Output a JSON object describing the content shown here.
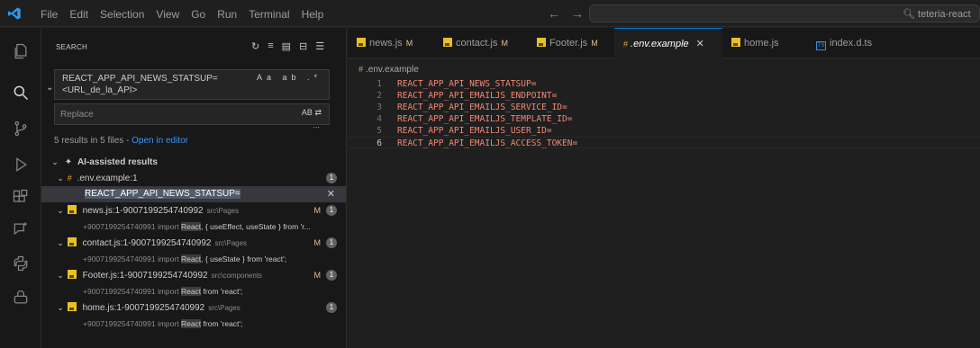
{
  "menu": [
    "File",
    "Edit",
    "Selection",
    "View",
    "Go",
    "Run",
    "Terminal",
    "Help"
  ],
  "nav": {
    "back": "←",
    "forward": "→"
  },
  "command_center": {
    "label": "teteria-react"
  },
  "sidebar": {
    "title": "SEARCH",
    "search_value": "REACT_APP_API_NEWS_STATSUP=<URL_de_la_API>",
    "search_options": "Aa ab .*",
    "replace_placeholder": "Replace",
    "replace_options": "AB",
    "replace_more": "...",
    "results_prefix": "5 results in 5 files - ",
    "open_in_editor": "Open in editor",
    "ai_results_label": "AI-assisted results",
    "env_file": {
      "name": ".env.example:1",
      "count": "1",
      "match": "REACT_APP_API_NEWS_STATSUP="
    },
    "files": [
      {
        "name": "news.js:1-9007199254740992",
        "path": "src\\Pages",
        "flag": "M",
        "count": "1",
        "pre": "+9007199254740991 import ",
        "hit": "React",
        "post": ", { useEffect, useState } from 'r..."
      },
      {
        "name": "contact.js:1-9007199254740992",
        "path": "src\\Pages",
        "flag": "M",
        "count": "1",
        "pre": "+9007199254740991 import ",
        "hit": "React",
        "post": ", { useState } from 'react';"
      },
      {
        "name": "Footer.js:1-9007199254740992",
        "path": "src\\components",
        "flag": "M",
        "count": "1",
        "pre": "+9007199254740991 import ",
        "hit": "React",
        "post": " from 'react';"
      },
      {
        "name": "home.js:1-9007199254740992",
        "path": "src\\Pages",
        "flag": "",
        "count": "1",
        "pre": "+9007199254740991 import ",
        "hit": "React",
        "post": " from 'react';"
      }
    ]
  },
  "tabs": [
    {
      "label": "news.js",
      "flag": "M"
    },
    {
      "label": "contact.js",
      "flag": "M"
    },
    {
      "label": "Footer.js",
      "flag": "M"
    },
    {
      "label": ".env.example",
      "close": "✕"
    },
    {
      "label": "home.js"
    },
    {
      "label": "index.d.ts"
    }
  ],
  "editor": {
    "breadcrumb": ".env.example",
    "lines": [
      {
        "n": "1",
        "text": "REACT_APP_API_NEWS_STATSUP="
      },
      {
        "n": "2",
        "text": "REACT_APP_API_EMAILJS_ENDPOINT="
      },
      {
        "n": "3",
        "text": "REACT_APP_API_EMAILJS_SERVICE_ID="
      },
      {
        "n": "4",
        "text": "REACT_APP_API_EMAILJS_TEMPLATE_ID="
      },
      {
        "n": "5",
        "text": "REACT_APP_API_EMAILJS_USER_ID="
      },
      {
        "n": "6",
        "text": "REACT_APP_API_EMAILJS_ACCESS_TOKEN="
      }
    ]
  },
  "colors": {
    "accent": "#0078d4",
    "token": "#f48771",
    "modified": "#e2c08d",
    "link": "#3794ff"
  }
}
